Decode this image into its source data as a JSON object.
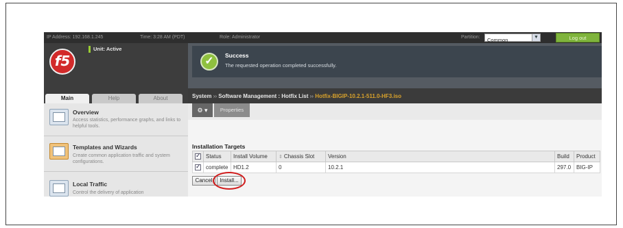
{
  "topbar": {
    "ip": "IP Address: 192.168.1.245",
    "time": "Time: 3:28 AM (PDT)",
    "role": "Role: Administrator",
    "partition_label": "Partition:",
    "partition_value": "Common",
    "logout_label": "Log out"
  },
  "header": {
    "logo_text": "f5",
    "unit_status": "Unit: Active"
  },
  "message": {
    "title": "Success",
    "text": "The requested operation completed successfully."
  },
  "tabs": [
    {
      "label": "Main",
      "active": true
    },
    {
      "label": "Help",
      "active": false
    },
    {
      "label": "About",
      "active": false
    }
  ],
  "breadcrumb": {
    "part1": "System",
    "sep": "››",
    "part2": "Software Management : Hotfix List",
    "part3": "Hotfix-BIGIP-10.2.1-511.0-HF3.iso"
  },
  "sidebar": {
    "items": [
      {
        "title": "Overview",
        "desc": "Access statistics, performance graphs, and links to helpful tools."
      },
      {
        "title": "Templates and Wizards",
        "desc": "Create common application traffic and system configurations."
      },
      {
        "title": "Local Traffic",
        "desc": "Control the delivery of application"
      }
    ]
  },
  "toolbar": {
    "gear_label": "⚙ ▾",
    "properties_label": "Properties"
  },
  "section": {
    "title": "Installation Targets"
  },
  "table": {
    "columns": [
      "Status",
      "Install Volume",
      "Chassis Slot",
      "Version",
      "Build",
      "Product"
    ],
    "rows": [
      {
        "status": "complete",
        "volume": "HD1.2",
        "slot": "0",
        "version": "10.2.1",
        "build": "297.0",
        "product": "BIG-IP"
      }
    ]
  },
  "buttons": {
    "cancel": "Cancel",
    "install": "Install..."
  },
  "colors": {
    "accent_green": "#8fc13f",
    "highlight_red": "#d01c1c",
    "breadcrumb_orange": "#d9a22b"
  }
}
